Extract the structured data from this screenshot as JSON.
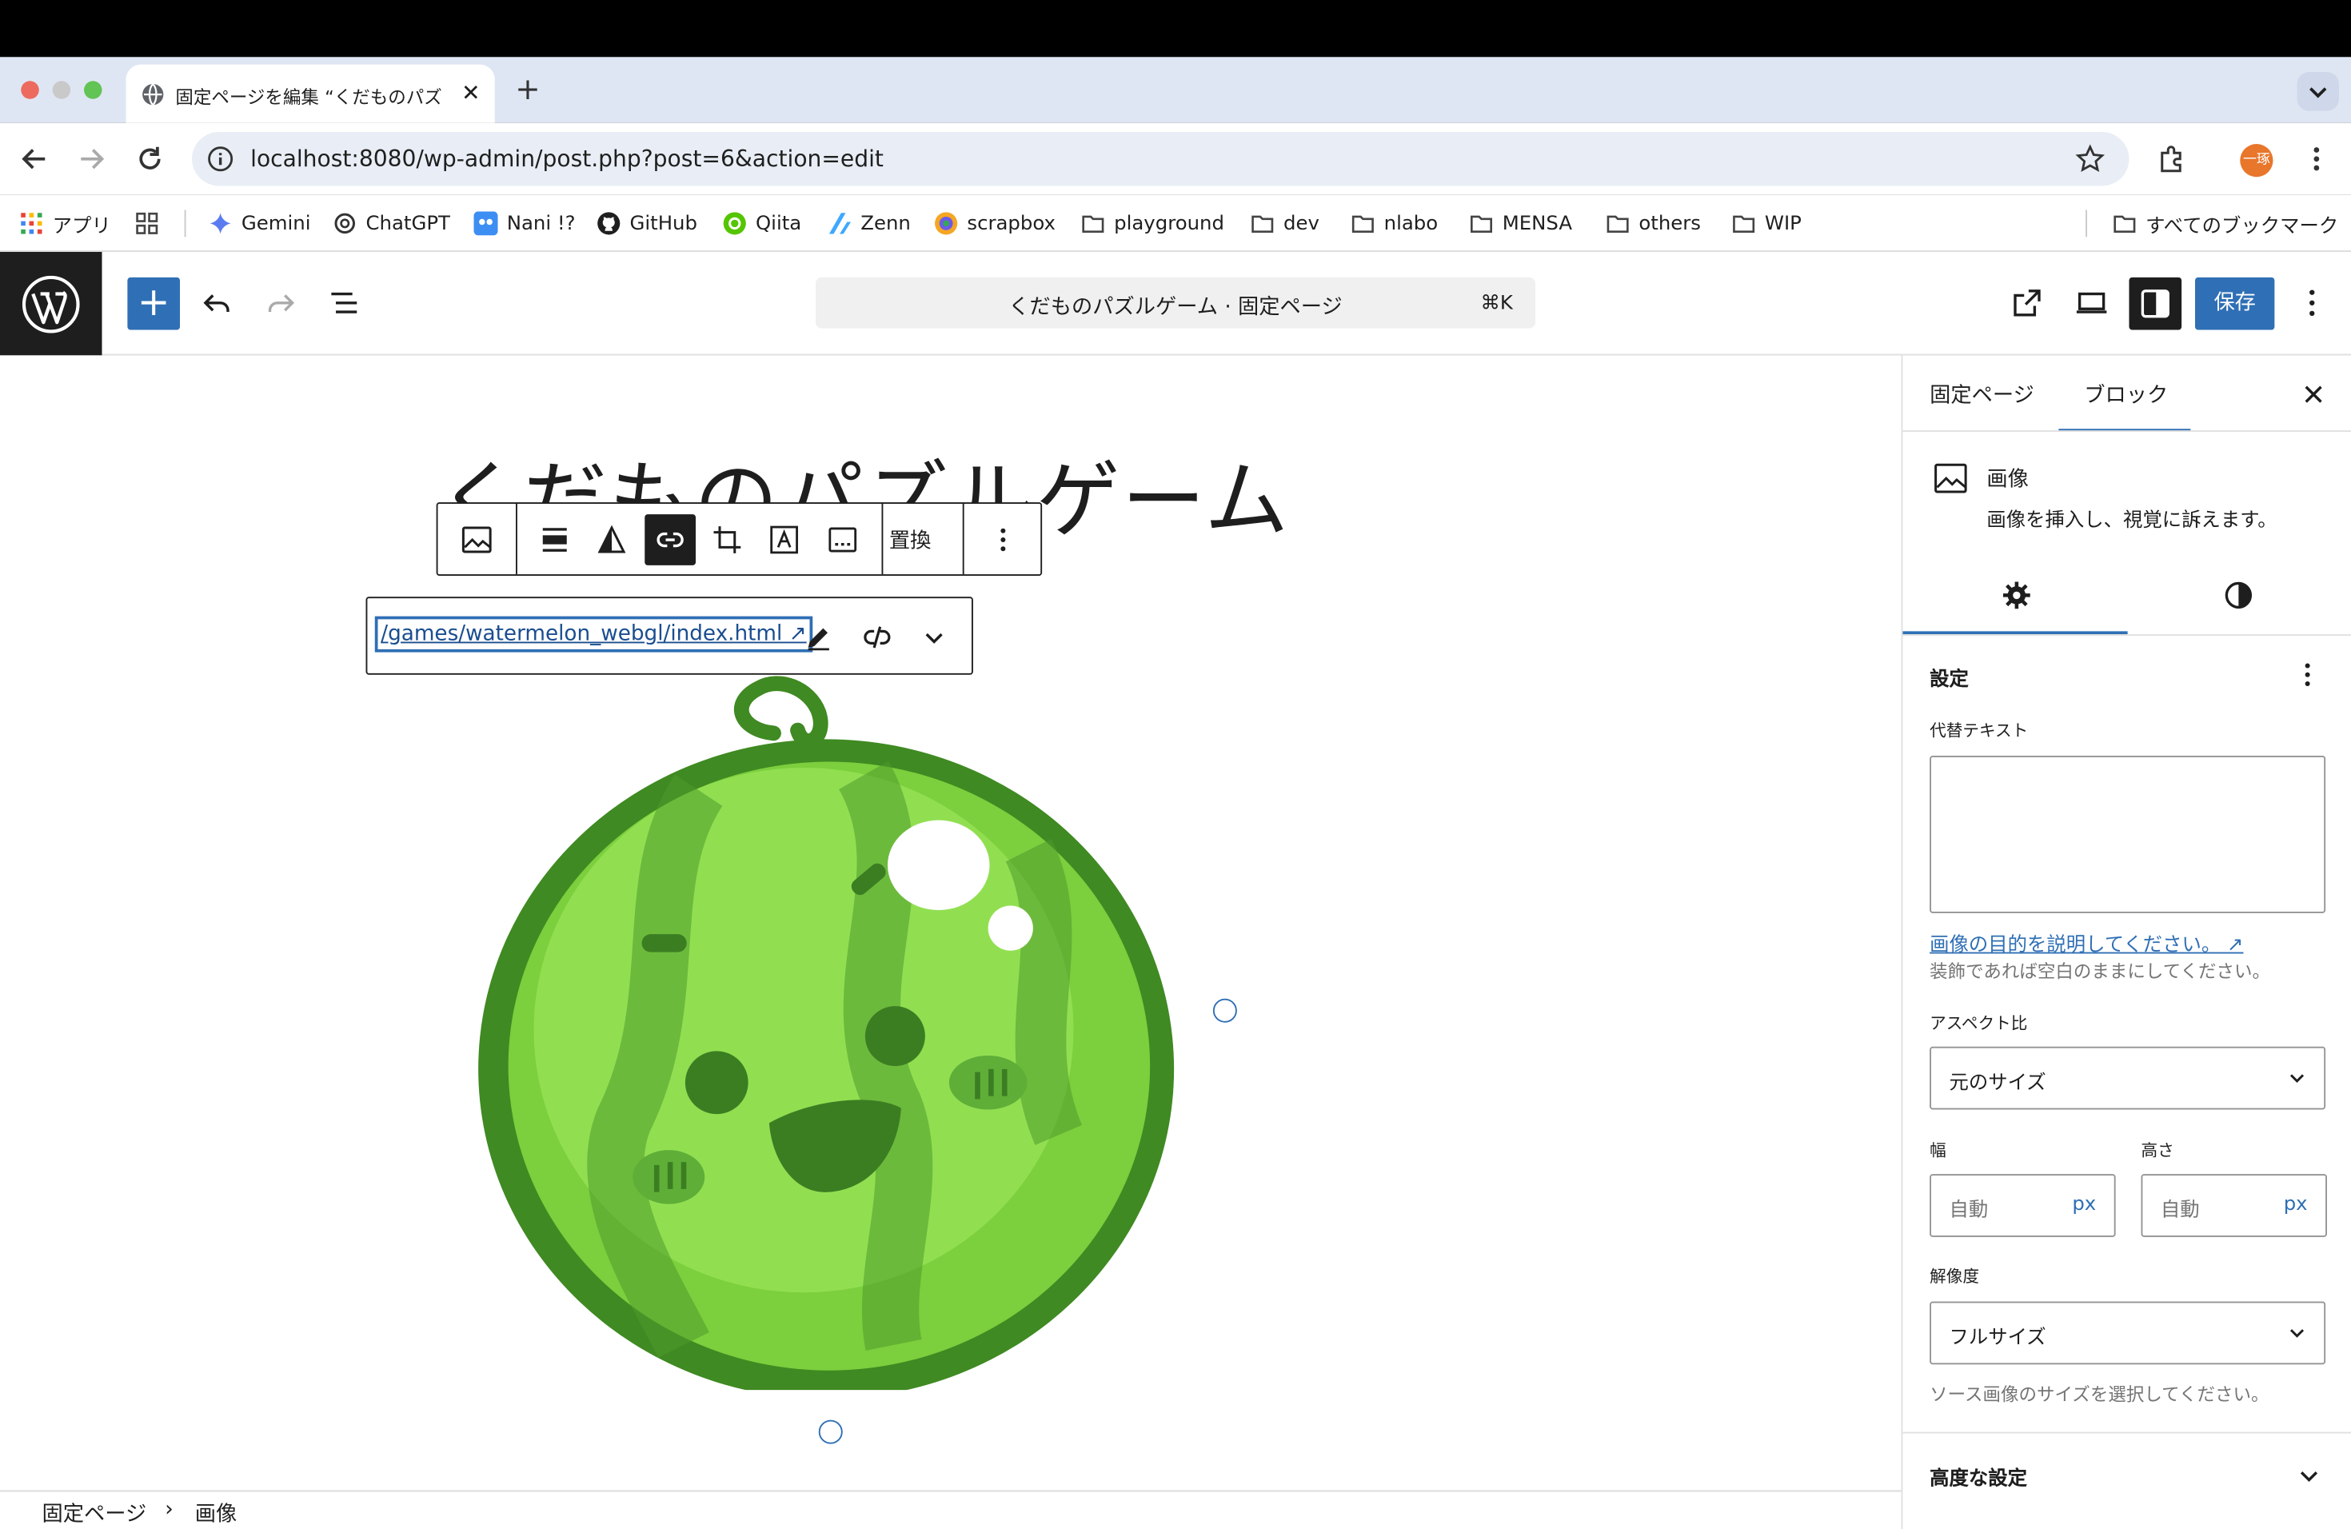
{
  "browser": {
    "tab_title": "固定ページを編集 “くだものパズ",
    "url": "localhost:8080/wp-admin/post.php?post=6&action=edit",
    "profile_initial": "一琢",
    "bookmarks": [
      {
        "label": "アプリ",
        "icon": "apps-grid-icon"
      },
      {
        "label": "",
        "icon": "tab-groups-icon"
      },
      {
        "label": "Gemini",
        "icon": "gemini-icon"
      },
      {
        "label": "ChatGPT",
        "icon": "chatgpt-icon"
      },
      {
        "label": "Nani !?",
        "icon": "nani-icon"
      },
      {
        "label": "GitHub",
        "icon": "github-icon"
      },
      {
        "label": "Qiita",
        "icon": "qiita-icon"
      },
      {
        "label": "Zenn",
        "icon": "zenn-icon"
      },
      {
        "label": "scrapbox",
        "icon": "scrapbox-icon"
      },
      {
        "label": "playground",
        "icon": "folder-icon"
      },
      {
        "label": "dev",
        "icon": "folder-icon"
      },
      {
        "label": "nlabo",
        "icon": "folder-icon"
      },
      {
        "label": "MENSA",
        "icon": "folder-icon"
      },
      {
        "label": "others",
        "icon": "folder-icon"
      },
      {
        "label": "WIP",
        "icon": "folder-icon"
      }
    ],
    "all_bookmarks_label": "すべてのブックマーク"
  },
  "editor": {
    "command_title": "くだものパズルゲーム · 固定ページ",
    "command_shortcut": "⌘K",
    "save_label": "保存",
    "post_title": "くだものパズルゲーム",
    "toolbar_replace": "置換",
    "link_url": "/games/watermelon_webgl/index.html ↗",
    "breadcrumb": [
      "固定ページ",
      "›",
      "画像"
    ]
  },
  "sidebar": {
    "tabs": [
      "固定ページ",
      "ブロック"
    ],
    "active_tab": "ブロック",
    "block_title": "画像",
    "block_description": "画像を挿入し、視覚に訴えます。",
    "panel_title": "設定",
    "alt_label": "代替テキスト",
    "alt_value": "",
    "alt_help_link": "画像の目的を説明してください。 ↗",
    "alt_help": "装飾であれば空白のままにしてください。",
    "aspect_label": "アスペクト比",
    "aspect_value": "元のサイズ",
    "width_label": "幅",
    "height_label": "高さ",
    "width_placeholder": "自動",
    "height_placeholder": "自動",
    "unit": "px",
    "resolution_label": "解像度",
    "resolution_value": "フルサイズ",
    "resolution_help": "ソース画像のサイズを選択してください。",
    "advanced_label": "高度な設定"
  },
  "colors": {
    "accent": "#2f6fb5",
    "dark": "#1e1e1e",
    "melon_dark": "#3f8a22",
    "melon_light": "#8fd94a"
  }
}
